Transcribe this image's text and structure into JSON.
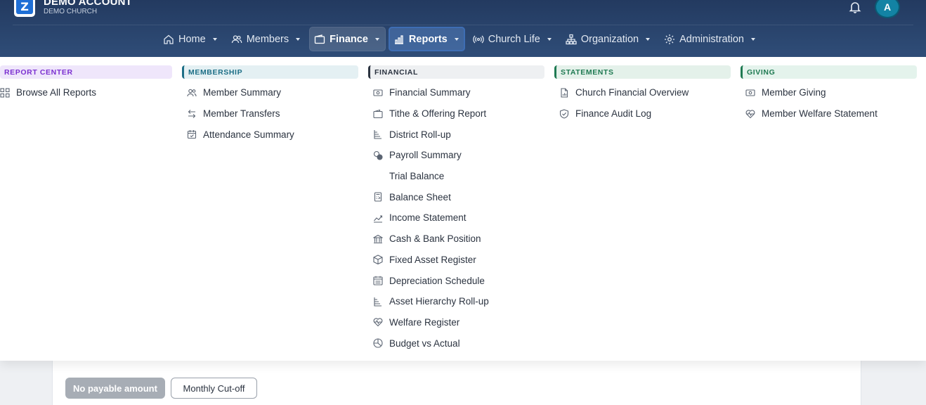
{
  "brand": {
    "title": "DEMO ACCOUNT",
    "subtitle": "DEMO CHURCH",
    "logo_letter": "Z"
  },
  "user": {
    "avatar_initial": "A"
  },
  "nav": [
    {
      "label": "Home",
      "icon": "home-icon"
    },
    {
      "label": "Members",
      "icon": "users-icon"
    },
    {
      "label": "Finance",
      "icon": "wallet-icon"
    },
    {
      "label": "Reports",
      "icon": "bar-chart-icon"
    },
    {
      "label": "Church Life",
      "icon": "broadcast-icon"
    },
    {
      "label": "Organization",
      "icon": "org-chart-icon"
    },
    {
      "label": "Administration",
      "icon": "gear-icon"
    }
  ],
  "menu": {
    "report_center": {
      "title": "REPORT CENTER",
      "color": "#7b2fd0",
      "bg": "#efe6fb",
      "items": [
        {
          "label": "Browse All Reports",
          "icon": "grid-icon"
        }
      ]
    },
    "membership": {
      "title": "MEMBERSHIP",
      "color": "#1c6e86",
      "bg": "#e4f0f3",
      "items": [
        {
          "label": "Member Summary",
          "icon": "users-icon"
        },
        {
          "label": "Member Transfers",
          "icon": "transfer-icon"
        },
        {
          "label": "Attendance Summary",
          "icon": "calendar-check-icon"
        }
      ]
    },
    "financial": {
      "title": "FINANCIAL",
      "color": "#2b3340",
      "bg": "#eef0f2",
      "items": [
        {
          "label": "Financial Summary",
          "icon": "cash-icon"
        },
        {
          "label": "Tithe & Offering Report",
          "icon": "wallet-icon"
        },
        {
          "label": "District Roll-up",
          "icon": "hierarchy-icon"
        },
        {
          "label": "Payroll Summary",
          "icon": "coins-icon"
        },
        {
          "label": "Trial Balance",
          "icon": ""
        },
        {
          "label": "Balance Sheet",
          "icon": "calculator-icon"
        },
        {
          "label": "Income Statement",
          "icon": "trend-icon"
        },
        {
          "label": "Cash & Bank Position",
          "icon": "bank-icon"
        },
        {
          "label": "Fixed Asset Register",
          "icon": "box-icon"
        },
        {
          "label": "Depreciation Schedule",
          "icon": "calendar-icon"
        },
        {
          "label": "Asset Hierarchy Roll-up",
          "icon": "hierarchy-icon"
        },
        {
          "label": "Welfare Register",
          "icon": "heart-pulse-icon"
        },
        {
          "label": "Budget vs Actual",
          "icon": "pie-icon"
        }
      ]
    },
    "statements": {
      "title": "STATEMENTS",
      "color": "#1f7a52",
      "bg": "#e4f1ea",
      "items": [
        {
          "label": "Church Financial Overview",
          "icon": "document-chart-icon"
        },
        {
          "label": "Finance Audit Log",
          "icon": "shield-check-icon"
        }
      ]
    },
    "giving": {
      "title": "GIVING",
      "color": "#1f7a52",
      "bg": "#e4f3ec",
      "items": [
        {
          "label": "Member Giving",
          "icon": "cash-icon"
        },
        {
          "label": "Member Welfare Statement",
          "icon": "heart-pulse-icon"
        }
      ]
    }
  },
  "page": {
    "chip_disabled": "No payable amount",
    "chip_outline": "Monthly Cut-off"
  }
}
